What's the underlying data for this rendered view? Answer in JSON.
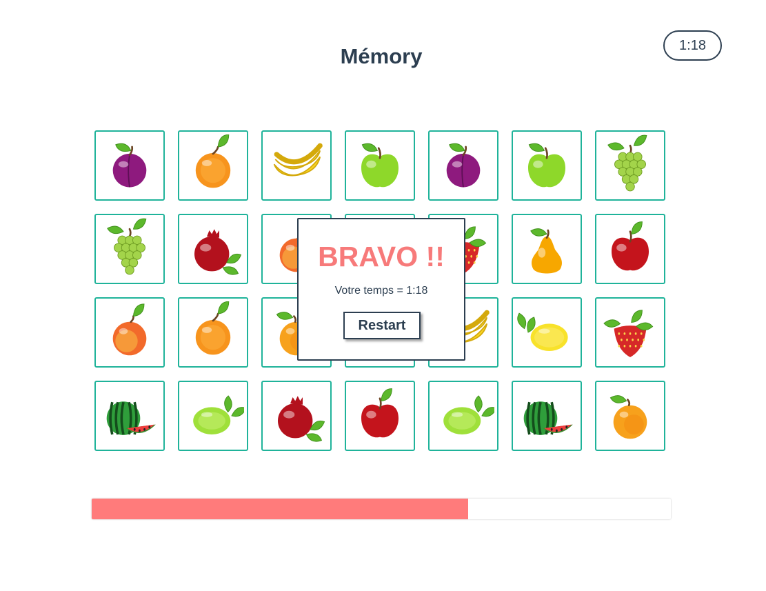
{
  "app": {
    "title": "Mémory",
    "timer": "1:18"
  },
  "board": {
    "columns": 7,
    "cards": [
      [
        "plum",
        "orange",
        "banana",
        "green-apple",
        "plum",
        "green-apple",
        "grapes"
      ],
      [
        "grapes",
        "pomegranate",
        "peach",
        "hidden",
        "strawberry",
        "pear",
        "red-apple"
      ],
      [
        "peach",
        "orange",
        "apricot",
        "hidden",
        "banana",
        "lemon",
        "strawberry"
      ],
      [
        "watermelon",
        "lime",
        "pomegranate",
        "red-apple",
        "lime",
        "watermelon",
        "apricot"
      ]
    ]
  },
  "modal": {
    "title": "BRAVO !!",
    "text": "Votre temps = 1:18",
    "button_label": "Restart"
  },
  "progress": {
    "fraction": 0.65
  },
  "colors": {
    "text": "#2c3e50",
    "card_border": "#1fb39a",
    "accent": "#f77a7a",
    "progress_fill": "#ff7b7b"
  }
}
